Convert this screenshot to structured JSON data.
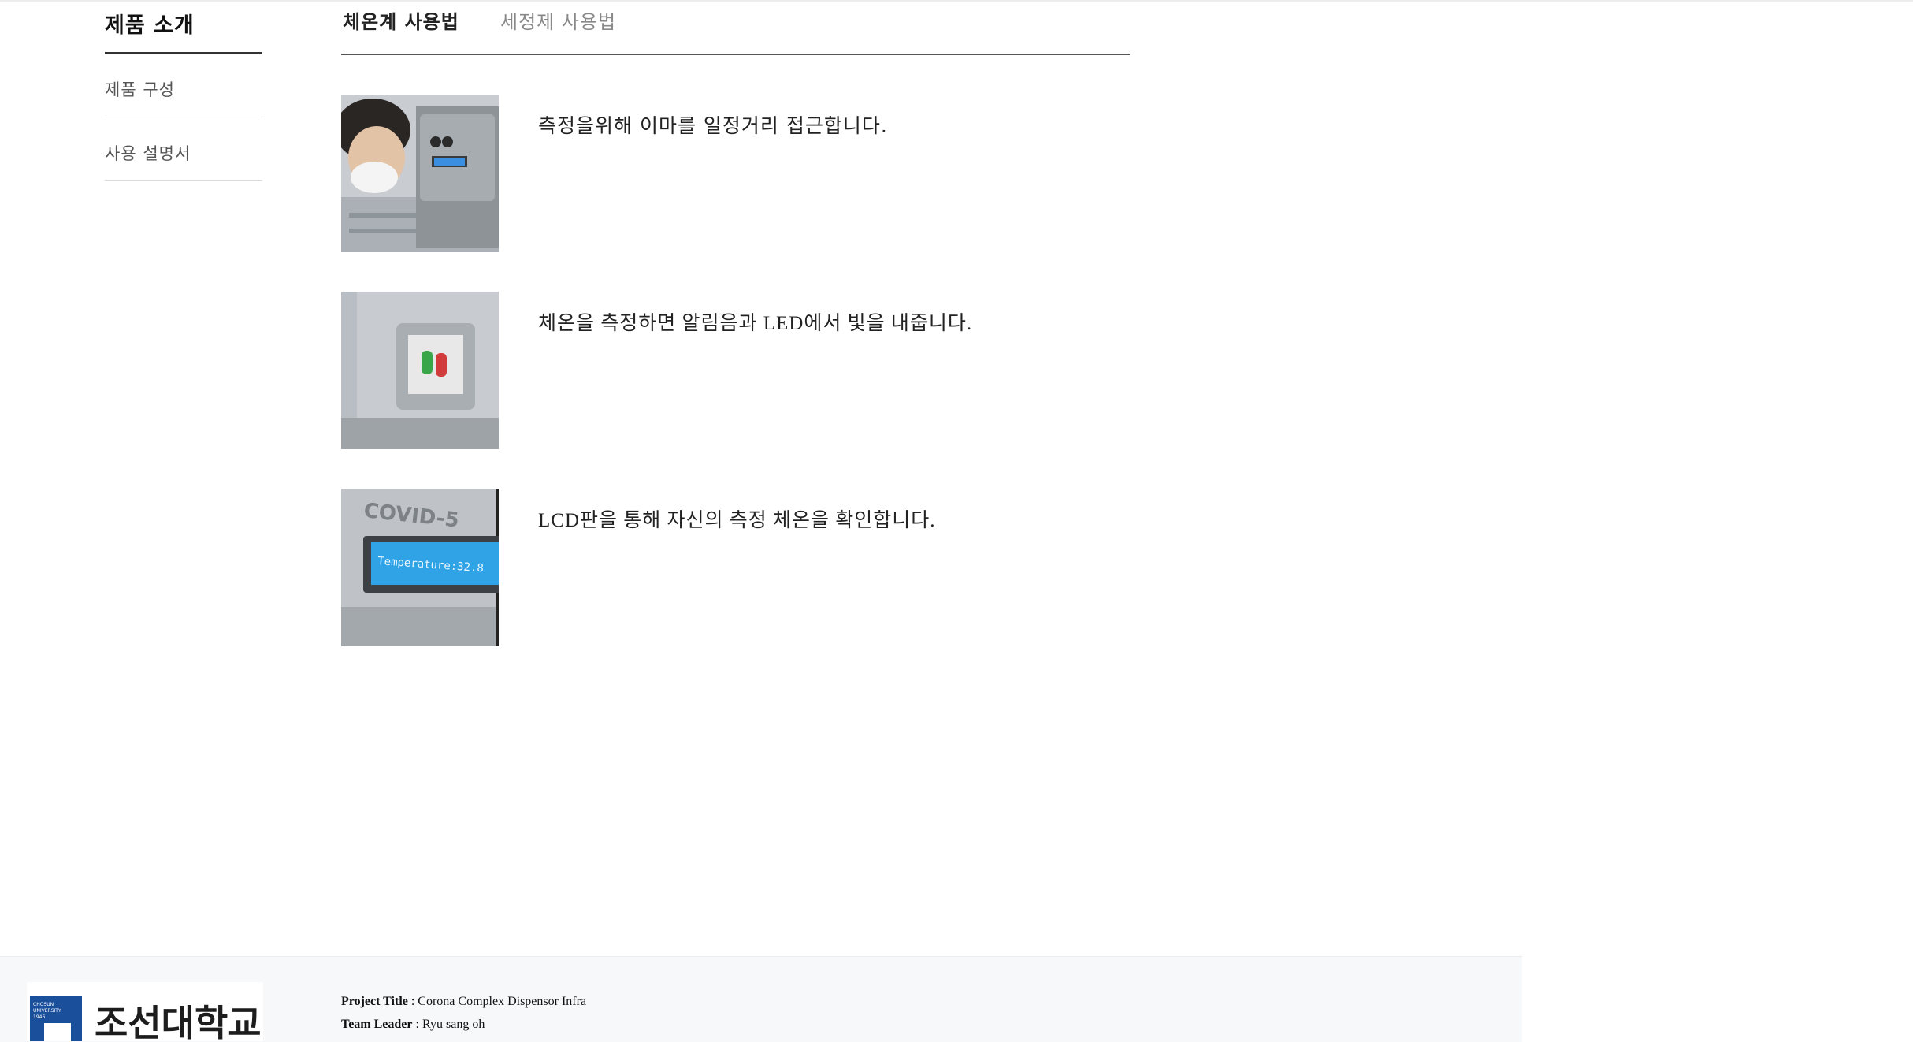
{
  "sidebar": {
    "title": "제품 소개",
    "items": [
      {
        "label": "제품 구성"
      },
      {
        "label": "사용 설명서"
      }
    ]
  },
  "tabs": [
    {
      "label": "체온계 사용법",
      "active": true
    },
    {
      "label": "세정제 사용법",
      "active": false
    }
  ],
  "steps": [
    {
      "text": "측정을위해 이마를 일정거리 접근합니다.",
      "image": "person-forehead-to-device-photo"
    },
    {
      "text": "체온을 측정하면 알림음과 LED에서 빛을 내줍니다.",
      "image": "led-lights-photo"
    },
    {
      "text": "LCD판을 통해 자신의 측정 체온을 확인합니다.",
      "image": "lcd-display-photo",
      "photo_brand_text": "COVID-5",
      "photo_lcd_text": "Temperature:32.8"
    }
  ],
  "footer": {
    "logo_text": "조선대학교",
    "logo_seal_text": "CHOSUN UNIVERSITY 1946",
    "project_title_label": "Project Title",
    "project_title_value": " : Corona Complex Dispensor Infra",
    "team_leader_label": "Team Leader",
    "team_leader_value": " : Ryu sang oh"
  },
  "colors": {
    "accent_rule": "#333333",
    "footer_bg": "#f7f8fa",
    "logo_blue": "#1a4f9c"
  }
}
